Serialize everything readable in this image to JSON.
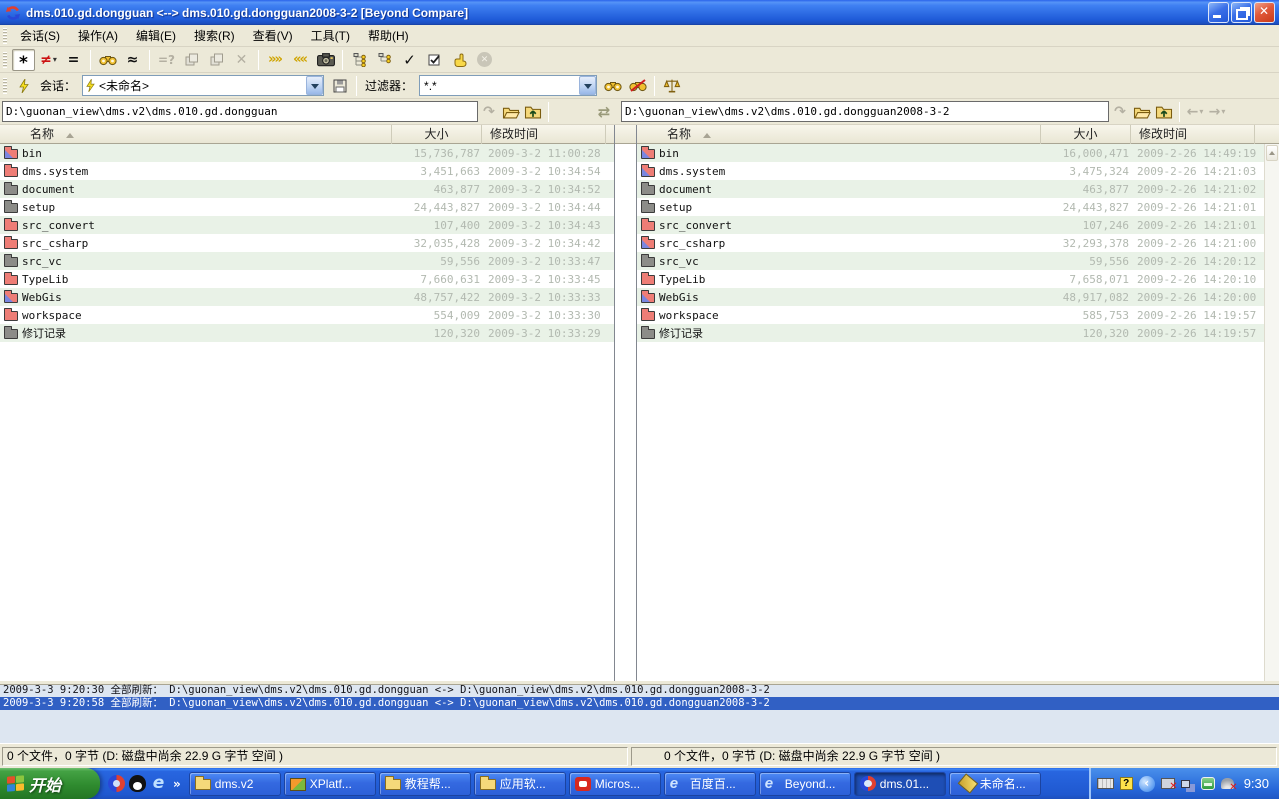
{
  "window": {
    "title": "dms.010.gd.dongguan <--> dms.010.gd.dongguan2008-3-2  [Beyond Compare]"
  },
  "menu": {
    "items": [
      {
        "label": "会话(S)"
      },
      {
        "label": "操作(A)"
      },
      {
        "label": "编辑(E)"
      },
      {
        "label": "搜索(R)"
      },
      {
        "label": "查看(V)"
      },
      {
        "label": "工具(T)"
      },
      {
        "label": "帮助(H)"
      }
    ]
  },
  "toolbar": {
    "glyphs": {
      "show_all": "*",
      "show_diff": "≠",
      "show_same": "=",
      "quick_compare": "≈",
      "rules_compare": "=?",
      "delete": "✕",
      "sync_right": "»»",
      "sync_left": "««",
      "select_check": "✓",
      "stop": "✕",
      "dropdown": "▾"
    }
  },
  "session_bar": {
    "session_label": "会话：",
    "session_value": "<未命名>",
    "filter_label": "过滤器：",
    "filter_value": "*.*"
  },
  "paths": {
    "left": "D:\\guonan_view\\dms.v2\\dms.010.gd.dongguan",
    "right": "D:\\guonan_view\\dms.v2\\dms.010.gd.dongguan2008-3-2",
    "glyphs": {
      "refresh": "↷",
      "swap": "⇄",
      "back": "←",
      "forward": "→",
      "dropdown": "▾"
    }
  },
  "panels": {
    "columns": {
      "name": "名称",
      "size": "大小",
      "modified": "修改时间"
    },
    "left": {
      "rows": [
        {
          "name": "bin",
          "size": "15,736,787",
          "modified": "2009-3-2 11:00:28",
          "icon": "mixed"
        },
        {
          "name": "dms.system",
          "size": "3,451,663",
          "modified": "2009-3-2 10:34:54",
          "icon": "red"
        },
        {
          "name": "document",
          "size": "463,877",
          "modified": "2009-3-2 10:34:52",
          "icon": "gray"
        },
        {
          "name": "setup",
          "size": "24,443,827",
          "modified": "2009-3-2 10:34:44",
          "icon": "gray"
        },
        {
          "name": "src_convert",
          "size": "107,400",
          "modified": "2009-3-2 10:34:43",
          "icon": "red"
        },
        {
          "name": "src_csharp",
          "size": "32,035,428",
          "modified": "2009-3-2 10:34:42",
          "icon": "red"
        },
        {
          "name": "src_vc",
          "size": "59,556",
          "modified": "2009-3-2 10:33:47",
          "icon": "gray"
        },
        {
          "name": "TypeLib",
          "size": "7,660,631",
          "modified": "2009-3-2 10:33:45",
          "icon": "red"
        },
        {
          "name": "WebGis",
          "size": "48,757,422",
          "modified": "2009-3-2 10:33:33",
          "icon": "mixed"
        },
        {
          "name": "workspace",
          "size": "554,009",
          "modified": "2009-3-2 10:33:30",
          "icon": "red"
        },
        {
          "name": "修订记录",
          "size": "120,320",
          "modified": "2009-3-2 10:33:29",
          "icon": "gray"
        }
      ]
    },
    "right": {
      "rows": [
        {
          "name": "bin",
          "size": "16,000,471",
          "modified": "2009-2-26 14:49:19",
          "icon": "mixed"
        },
        {
          "name": "dms.system",
          "size": "3,475,324",
          "modified": "2009-2-26 14:21:03",
          "icon": "mixed"
        },
        {
          "name": "document",
          "size": "463,877",
          "modified": "2009-2-26 14:21:02",
          "icon": "gray"
        },
        {
          "name": "setup",
          "size": "24,443,827",
          "modified": "2009-2-26 14:21:01",
          "icon": "gray"
        },
        {
          "name": "src_convert",
          "size": "107,246",
          "modified": "2009-2-26 14:21:01",
          "icon": "red"
        },
        {
          "name": "src_csharp",
          "size": "32,293,378",
          "modified": "2009-2-26 14:21:00",
          "icon": "mixed"
        },
        {
          "name": "src_vc",
          "size": "59,556",
          "modified": "2009-2-26 14:20:12",
          "icon": "gray"
        },
        {
          "name": "TypeLib",
          "size": "7,658,071",
          "modified": "2009-2-26 14:20:10",
          "icon": "red"
        },
        {
          "name": "WebGis",
          "size": "48,917,082",
          "modified": "2009-2-26 14:20:00",
          "icon": "mixed"
        },
        {
          "name": "workspace",
          "size": "585,753",
          "modified": "2009-2-26 14:19:57",
          "icon": "red"
        },
        {
          "name": "修订记录",
          "size": "120,320",
          "modified": "2009-2-26 14:19:57",
          "icon": "gray"
        }
      ]
    }
  },
  "log": {
    "lines": [
      {
        "text": "2009-3-3 9:20:30  全部刷新：  D:\\guonan_view\\dms.v2\\dms.010.gd.dongguan <-> D:\\guonan_view\\dms.v2\\dms.010.gd.dongguan2008-3-2",
        "selected": false
      },
      {
        "text": "2009-3-3 9:20:58  全部刷新：  D:\\guonan_view\\dms.v2\\dms.010.gd.dongguan <-> D:\\guonan_view\\dms.v2\\dms.010.gd.dongguan2008-3-2",
        "selected": true
      }
    ]
  },
  "status_bar": {
    "left": "0 个文件，0 字节  (D: 磁盘中尚余 22.9 G 字节 空间 )",
    "right": "0 个文件，0 字节  (D: 磁盘中尚余 22.9 G 字节 空间 )"
  },
  "taskbar": {
    "start_label": "开始",
    "overflow_chevron": "»",
    "buttons": [
      {
        "label": "dms.v2",
        "icon": "folder"
      },
      {
        "label": "XPlatf...",
        "icon": "xp"
      },
      {
        "label": "教程帮...",
        "icon": "folder"
      },
      {
        "label": "应用软...",
        "icon": "folder"
      },
      {
        "label": "Micros...",
        "icon": "redapp"
      },
      {
        "label": "百度百...",
        "icon": "ie"
      },
      {
        "label": "Beyond...",
        "icon": "ie"
      },
      {
        "label": "dms.01...",
        "icon": "bc",
        "active": true
      },
      {
        "label": "未命名...",
        "icon": "pen"
      }
    ],
    "tray": {
      "clock": "9:30",
      "help_glyph": "?",
      "chevron_glyph": "‹"
    }
  }
}
